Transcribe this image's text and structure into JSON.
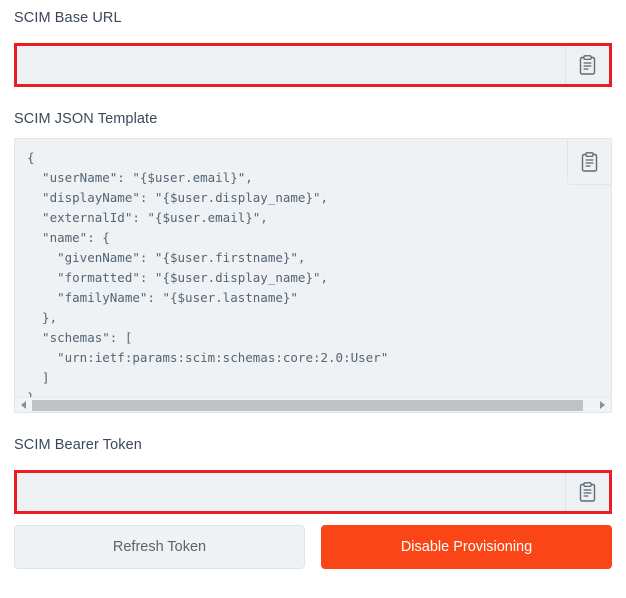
{
  "base_url": {
    "label": "SCIM Base URL",
    "value": "",
    "placeholder": "",
    "copy_icon": "clipboard-icon",
    "highlight_color": "#ec1c24"
  },
  "json_template": {
    "label": "SCIM JSON Template",
    "copy_icon": "clipboard-icon",
    "value": "{\n  \"userName\": \"{$user.email}\",\n  \"displayName\": \"{$user.display_name}\",\n  \"externalId\": \"{$user.email}\",\n  \"name\": {\n    \"givenName\": \"{$user.firstname}\",\n    \"formatted\": \"{$user.display_name}\",\n    \"familyName\": \"{$user.lastname}\"\n  },\n  \"schemas\": [\n    \"urn:ietf:params:scim:schemas:core:2.0:User\"\n  ]\n}",
    "scrollbar": {
      "left_arrow": "scroll-left-arrow-icon",
      "right_arrow": "scroll-right-arrow-icon"
    }
  },
  "bearer_token": {
    "label": "SCIM Bearer Token",
    "value": "",
    "placeholder": "",
    "copy_icon": "clipboard-icon",
    "highlight_color": "#ec1c24"
  },
  "actions": {
    "refresh_label": "Refresh Token",
    "disable_label": "Disable Provisioning",
    "disable_color": "#fa4616"
  }
}
